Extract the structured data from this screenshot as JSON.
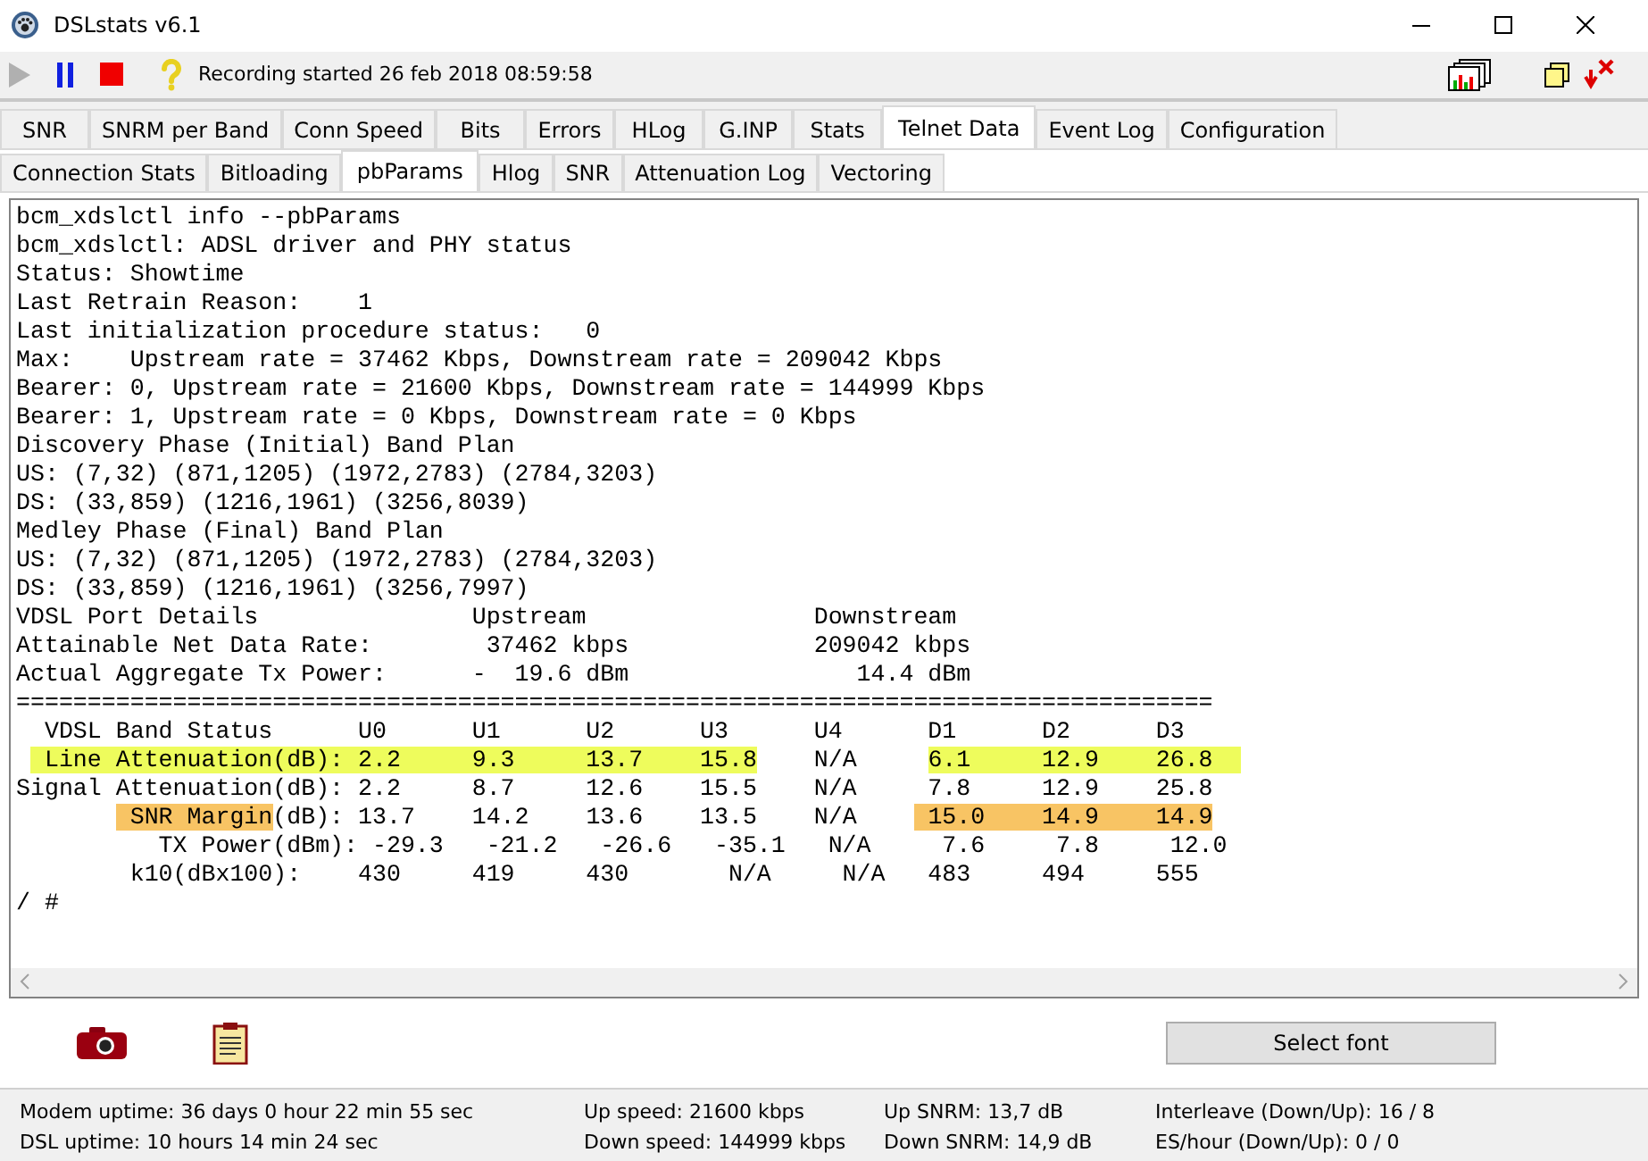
{
  "window": {
    "title": "DSLstats v6.1"
  },
  "toolbar": {
    "status_text": "Recording started 26 feb 2018 08:59:58"
  },
  "tabs": [
    {
      "label": "SNR",
      "selected": false
    },
    {
      "label": "SNRM per Band",
      "selected": false
    },
    {
      "label": "Conn Speed",
      "selected": false
    },
    {
      "label": "Bits",
      "selected": false
    },
    {
      "label": "Errors",
      "selected": false
    },
    {
      "label": "HLog",
      "selected": false
    },
    {
      "label": "G.INP",
      "selected": false
    },
    {
      "label": "Stats",
      "selected": false
    },
    {
      "label": "Telnet Data",
      "selected": true
    },
    {
      "label": "Event Log",
      "selected": false
    },
    {
      "label": "Configuration",
      "selected": false
    }
  ],
  "subtabs": [
    {
      "label": "Connection Stats",
      "selected": false
    },
    {
      "label": "Bitloading",
      "selected": false
    },
    {
      "label": "pbParams",
      "selected": true
    },
    {
      "label": "Hlog",
      "selected": false
    },
    {
      "label": "SNR",
      "selected": false
    },
    {
      "label": "Attenuation Log",
      "selected": false
    },
    {
      "label": "Vectoring",
      "selected": false
    }
  ],
  "terminal": {
    "lines": [
      {
        "segments": [
          {
            "text": "bcm_xdslctl info --pbParams"
          }
        ]
      },
      {
        "segments": [
          {
            "text": "bcm_xdslctl: ADSL driver and PHY status"
          }
        ]
      },
      {
        "segments": [
          {
            "text": "Status: Showtime"
          }
        ]
      },
      {
        "segments": [
          {
            "text": "Last Retrain Reason:    1"
          }
        ]
      },
      {
        "segments": [
          {
            "text": "Last initialization procedure status:   0"
          }
        ]
      },
      {
        "segments": [
          {
            "text": "Max:    Upstream rate = 37462 Kbps, Downstream rate = 209042 Kbps"
          }
        ]
      },
      {
        "segments": [
          {
            "text": "Bearer: 0, Upstream rate = 21600 Kbps, Downstream rate = 144999 Kbps"
          }
        ]
      },
      {
        "segments": [
          {
            "text": "Bearer: 1, Upstream rate = 0 Kbps, Downstream rate = 0 Kbps"
          }
        ]
      },
      {
        "segments": [
          {
            "text": "Discovery Phase (Initial) Band Plan"
          }
        ]
      },
      {
        "segments": [
          {
            "text": "US: (7,32) (871,1205) (1972,2783) (2784,3203)"
          }
        ]
      },
      {
        "segments": [
          {
            "text": "DS: (33,859) (1216,1961) (3256,8039)"
          }
        ]
      },
      {
        "segments": [
          {
            "text": "Medley Phase (Final) Band Plan"
          }
        ]
      },
      {
        "segments": [
          {
            "text": "US: (7,32) (871,1205) (1972,2783) (2784,3203)"
          }
        ]
      },
      {
        "segments": [
          {
            "text": "DS: (33,859) (1216,1961) (3256,7997)"
          }
        ]
      },
      {
        "segments": [
          {
            "text": "VDSL Port Details               Upstream                Downstream"
          }
        ]
      },
      {
        "segments": [
          {
            "text": "Attainable Net Data Rate:        37462 kbps             209042 kbps"
          }
        ]
      },
      {
        "segments": [
          {
            "text": "Actual Aggregate Tx Power:      -  19.6 dBm                14.4 dBm"
          }
        ]
      },
      {
        "segments": [
          {
            "text": "===================================================================================="
          }
        ]
      },
      {
        "segments": [
          {
            "text": "  VDSL Band Status      U0      U1      U2      U3      U4      D1      D2      D3"
          }
        ]
      },
      {
        "segments": [
          {
            "text": "  Line Attenuation(dB): 2.2     9.3     13.7    15.8",
            "color": "#eefc5c"
          },
          {
            "text": "    N/A     "
          },
          {
            "text": "6.1     12.9    26.8  ",
            "color": "#eefc5c"
          }
        ]
      },
      {
        "segments": [
          {
            "text": "Signal Attenuation(dB): 2.2     8.7     12.6    15.5    N/A     7.8     12.9    25.8"
          }
        ]
      },
      {
        "segments": [
          {
            "text": "        SNR Margin",
            "color": "#f8c464"
          },
          {
            "text": "(dB): 13.7    14.2    13.6    13.5    N/A    "
          },
          {
            "text": " 15.0    14.9    14.9",
            "color": "#f8c464"
          }
        ]
      },
      {
        "segments": [
          {
            "text": "          TX Power(dBm): -29.3   -21.2   -26.6   -35.1   N/A     7.6     7.8     12.0"
          }
        ]
      },
      {
        "segments": [
          {
            "text": "        k10(dBx100):    430     419     430       N/A     N/A   483     494     555"
          }
        ]
      },
      {
        "segments": [
          {
            "text": "/ #"
          }
        ]
      }
    ]
  },
  "select_font_button": "Select font",
  "status_bar": [
    [
      "Modem uptime: 36 days 0 hour 22 min 55 sec",
      "Up speed: 21600 kbps",
      "Up SNRM: 13,7 dB",
      "Interleave (Down/Up): 16 / 8"
    ],
    [
      "DSL uptime:  10 hours 14 min 24 sec",
      "Down speed: 144999 kbps",
      "Down SNRM: 14,9 dB",
      "ES/hour (Down/Up): 0 / 0"
    ]
  ]
}
